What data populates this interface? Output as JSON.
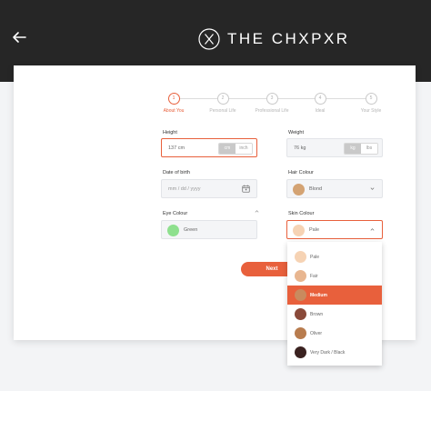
{
  "app": {
    "title": "THE CHXPXR"
  },
  "stepper": {
    "steps": [
      {
        "number": "1",
        "label": "About You",
        "active": true
      },
      {
        "number": "2",
        "label": "Personal Life",
        "active": false
      },
      {
        "number": "3",
        "label": "Professional Life",
        "active": false
      },
      {
        "number": "4",
        "label": "Ideal",
        "active": false
      },
      {
        "number": "5",
        "label": "Your Style",
        "active": false
      }
    ]
  },
  "form": {
    "height": {
      "label": "Height",
      "value": "137 cm",
      "units": [
        "cm",
        "inch"
      ],
      "selected_unit": "cm"
    },
    "weight": {
      "label": "Weight",
      "value": "76 kg",
      "units": [
        "kg",
        "lbs"
      ],
      "selected_unit": "kg"
    },
    "dob": {
      "label": "Date of birth",
      "placeholder": "mm / dd / yyyy"
    },
    "hair": {
      "label": "Hair Colour",
      "value": "Blond",
      "color": "#d4a373"
    },
    "eye": {
      "label": "Eye Colour",
      "value": "Green",
      "color": "#8ee08e"
    },
    "skin": {
      "label": "Skin Colour",
      "value": "Pale",
      "color": "#f6d3b4"
    }
  },
  "actions": {
    "next_label": "Next"
  },
  "skin_options": [
    {
      "label": "Pale",
      "color": "#f6d3b4",
      "selected": false
    },
    {
      "label": "Fair",
      "color": "#e8b690",
      "selected": false
    },
    {
      "label": "Medium",
      "color": "#c98a5e",
      "selected": true
    },
    {
      "label": "Brown",
      "color": "#8a4a3a",
      "selected": false
    },
    {
      "label": "Oliver",
      "color": "#b87c4e",
      "selected": false
    },
    {
      "label": "Very Dark / Black",
      "color": "#3a2220",
      "selected": false
    }
  ],
  "colors": {
    "accent": "#e8603c",
    "topbar": "#262626"
  }
}
